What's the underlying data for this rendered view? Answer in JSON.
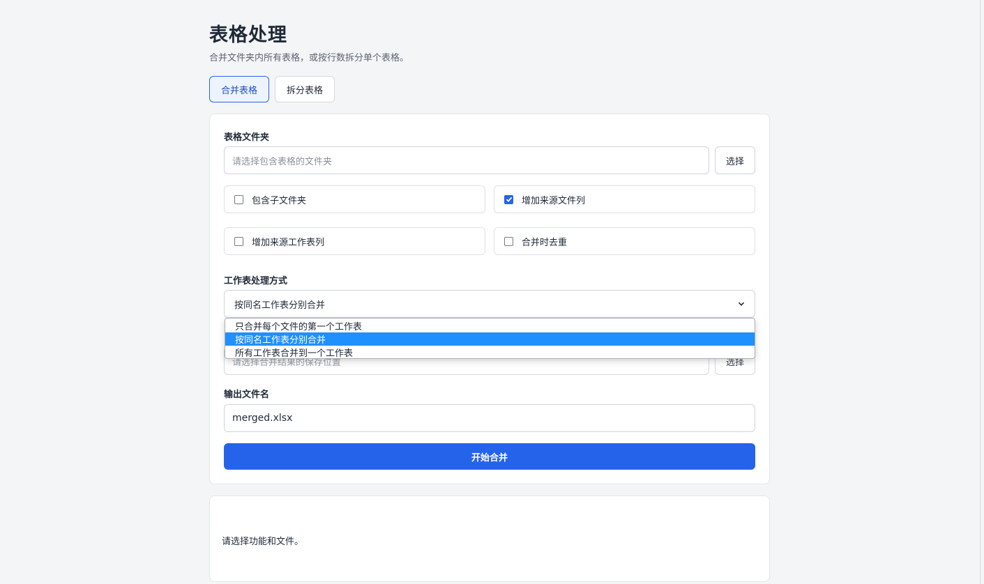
{
  "header": {
    "title": "表格处理",
    "subtitle": "合并文件夹内所有表格，或按行数拆分单个表格。"
  },
  "tabs": [
    {
      "label": "合并表格",
      "active": true
    },
    {
      "label": "拆分表格",
      "active": false
    }
  ],
  "merge_form": {
    "folder": {
      "label": "表格文件夹",
      "placeholder": "请选择包含表格的文件夹",
      "choose_label": "选择"
    },
    "options": [
      {
        "label": "包含子文件夹",
        "checked": false
      },
      {
        "label": "增加来源文件列",
        "checked": true
      },
      {
        "label": "增加来源工作表列",
        "checked": false
      },
      {
        "label": "合并时去重",
        "checked": false
      }
    ],
    "sheet_mode": {
      "label": "工作表处理方式",
      "selected": "按同名工作表分别合并",
      "options": [
        "只合并每个文件的第一个工作表",
        "按同名工作表分别合并",
        "所有工作表合并到一个工作表"
      ]
    },
    "output_location": {
      "placeholder": "请选择合并结果的保存位置",
      "choose_label": "选择"
    },
    "output_name": {
      "label": "输出文件名",
      "value": "merged.xlsx"
    },
    "start_label": "开始合并"
  },
  "status": {
    "message": "请选择功能和文件。"
  },
  "colors": {
    "accent": "#2563eb",
    "dropdown_highlight": "#1e90ff",
    "background": "#f4f5f7"
  }
}
